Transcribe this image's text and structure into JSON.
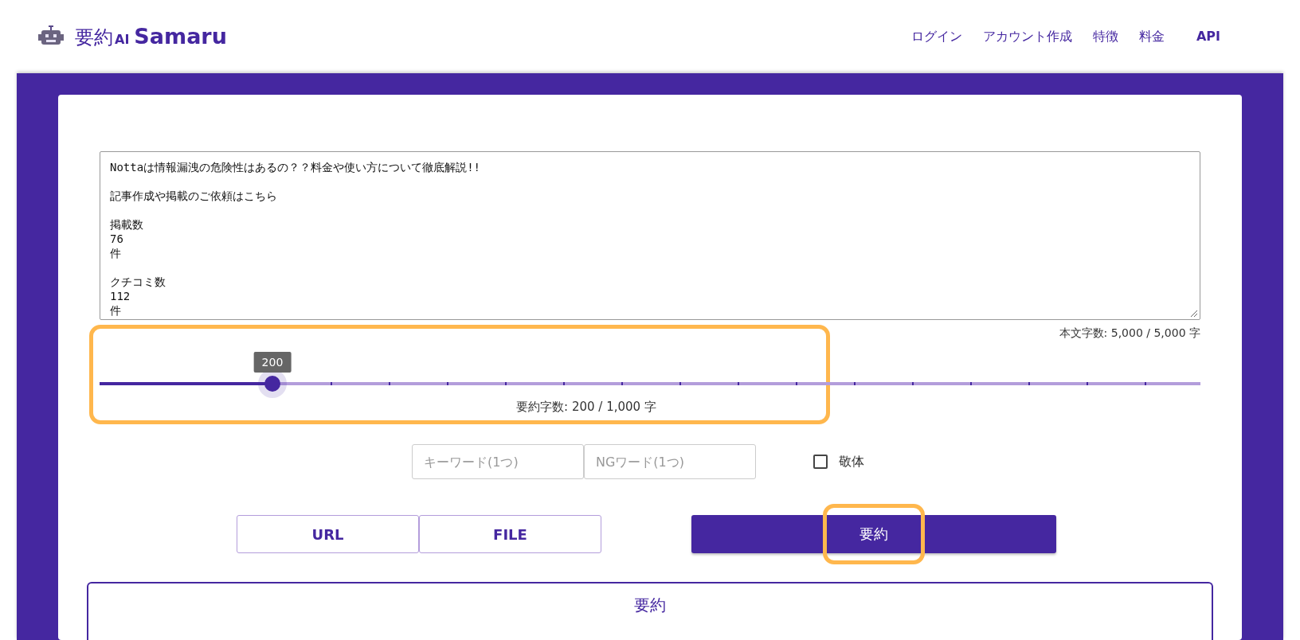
{
  "header": {
    "logo": {
      "prefix": "要約",
      "ai": "AI",
      "name": "Samaru"
    },
    "nav": [
      {
        "label": "ログイン",
        "bold": false
      },
      {
        "label": "アカウント作成",
        "bold": false
      },
      {
        "label": "特徴",
        "bold": false
      },
      {
        "label": "料金",
        "bold": false
      },
      {
        "label": "API",
        "bold": true
      }
    ]
  },
  "source_text": {
    "paragraphs": [
      [
        "Nottaは情報漏洩の危険性はあるの？？料金や使い方について徹底解説!!"
      ],
      [
        "記事作成や掲載のご依頼はこちら"
      ],
      [
        "掲載数",
        "76",
        "件"
      ],
      [
        "クチコミ数",
        "112",
        "件"
      ]
    ],
    "counter": "本文字数: 5,000 / 5,000 字"
  },
  "length_slider": {
    "level": 0.157,
    "tooltip": "200",
    "reading": "要約字数: 200 / 1,000 字",
    "highlighted": true
  },
  "keyword_field": {
    "placeholder": "キーワード(1つ)"
  },
  "ng_field": {
    "placeholder": "NGワード(1つ)"
  },
  "polite_checkbox": {
    "label": "敬体",
    "checked": false
  },
  "source_buttons": [
    {
      "label": "URL"
    },
    {
      "label": "FILE"
    }
  ],
  "summarize_button": {
    "label": "要約",
    "highlighted": true
  },
  "result_panel": {
    "title": "要約"
  }
}
